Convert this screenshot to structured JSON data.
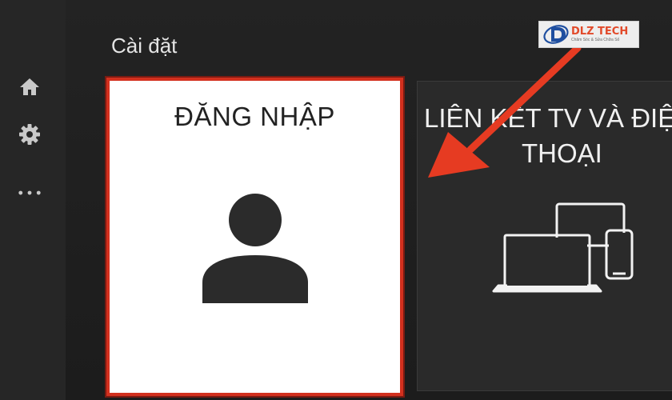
{
  "header": {
    "title": "Cài đặt"
  },
  "sidebar": {
    "items": [
      {
        "icon": "home-icon"
      },
      {
        "icon": "gear-icon"
      },
      {
        "icon": "more-dots-icon"
      }
    ]
  },
  "cards": {
    "signin": {
      "title": "ĐĂNG NHẬP",
      "icon": "user-icon"
    },
    "link_tv": {
      "title_line1": "LIÊN KẾT TV VÀ ĐIỆN",
      "title_line2": "THOẠI",
      "icon": "devices-icon"
    }
  },
  "watermark": {
    "name": "DLZ TECH",
    "tagline": "Chăm Sóc & Sửa Chữa Số"
  },
  "colors": {
    "accent_border": "#d3301e",
    "arrow": "#e63b22",
    "background": "#1e1e1e"
  }
}
